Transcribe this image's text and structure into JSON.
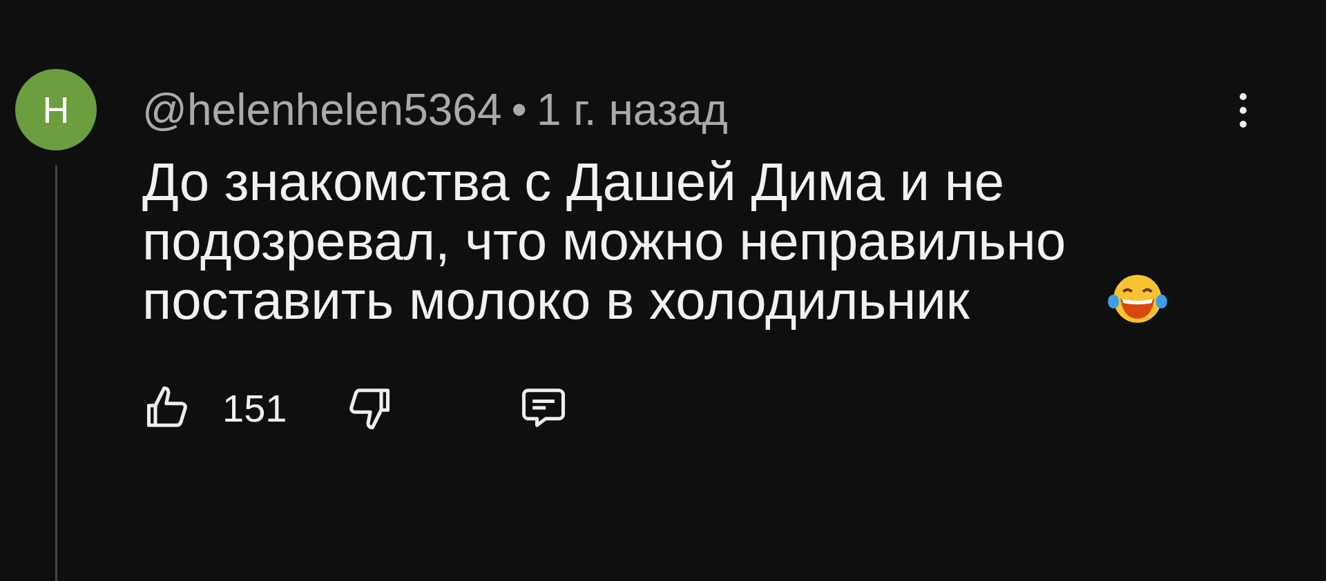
{
  "comment": {
    "avatar": {
      "letter": "H",
      "color": "#6b9e3f"
    },
    "author": "@helenhelen5364",
    "separator": "•",
    "time": "1 г. назад",
    "text": "До знакомства с Дашей Дима и не подозревал, что можно неправильно поставить молоко в холодильник",
    "likes": "151"
  }
}
